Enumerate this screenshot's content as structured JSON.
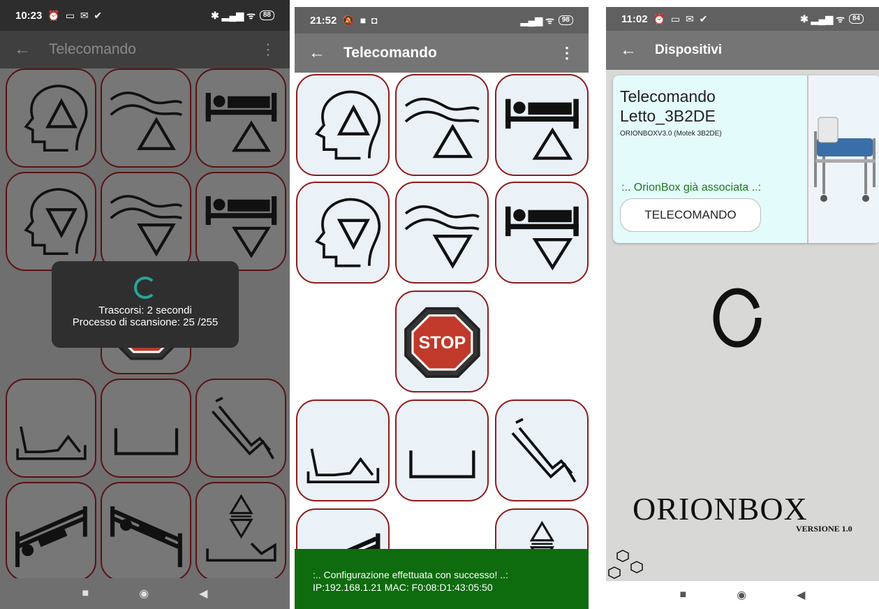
{
  "colors": {
    "appbar": "#757575",
    "border": "#8e1c1c",
    "button_bg": "#eaf1f7",
    "snackbar": "#0e6b0e",
    "card": "#e4fbfb",
    "accent_green": "#1e7a1e",
    "spinner": "#26a69a"
  },
  "phone1": {
    "status_time": "10:23",
    "status_icons": "⏰ ▭ ✉ ✔",
    "battery": "88",
    "title": "Telecomando",
    "dialog": {
      "elapsed": "Trascorsi: 2 secondi",
      "progress": "Processo di scansione: 25 /255"
    }
  },
  "phone2": {
    "status_time": "21:52",
    "status_icons": "🔕 ■ ◘",
    "battery": "98",
    "title": "Telecomando",
    "stop_label": "STOP",
    "snackbar": {
      "line1": ":.. Configurazione effettuata con successo! ..:",
      "line2": "IP:192.168.1.21   MAC: F0:08:D1:43:05:50"
    }
  },
  "phone3": {
    "status_time": "11:02",
    "status_icons": "⏰ ▭ ✉ ✔",
    "battery": "84",
    "title": "Dispositivi",
    "card": {
      "name_line1": "Telecomando",
      "name_line2": "Letto_3B2DE",
      "model": "ORIONBOXV3.0 (Motek 3B2DE)",
      "status": ":.. OrionBox già associata ..:",
      "button": "TELECOMANDO"
    },
    "brand": "ORIONBOX",
    "version": "VERSIONE 1.0"
  }
}
